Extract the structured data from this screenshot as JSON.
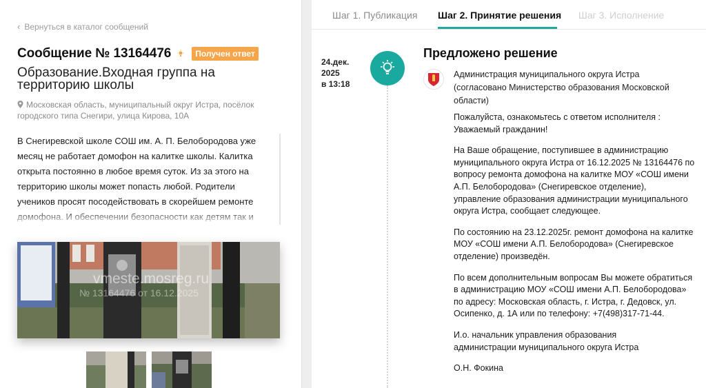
{
  "left": {
    "back_link": "Вернуться в каталог сообщений",
    "message_title": "Сообщение № 13164476",
    "status_badge": "Получен ответ",
    "category": "Образование.Входная группа на территорию школы",
    "address": "Московская область, муниципальный округ Истра, посёлок городского типа Снегири, улица Кирова, 10А",
    "description": "В Снегиревской школе СОШ им. А. П. Белобородова уже месяц не работает домофон на калитке школы. Калитка открыта постоянно в любое время суток. Из за этого на территорию школы может попасть любой. Родители учеников просят посодействовать в скорейшем ремонте домофона. И обеспечении безопасности как детям так и учителям.",
    "photo_watermark_site": "vmeste.mosreg.ru",
    "photo_watermark_id": "№ 13164476 от 16.12.2025"
  },
  "tabs": {
    "step1": "Шаг 1. Публикация",
    "step2": "Шаг 2. Принятие решения",
    "step3": "Шаг 3. Исполнение"
  },
  "timeline": {
    "date_line1": "24.дек.",
    "date_line2": "2025",
    "date_line3": "в 13:18"
  },
  "decision": {
    "title": "Предложено решение",
    "org": "Администрация муниципального округа Истра (согласовано Министерство образования Московской области)",
    "p1_line1": "Пожалуйста, ознакомьтесь с ответом исполнителя :",
    "p1_line2": "Уважаемый гражданин!",
    "p2": "На Ваше обращение, поступившее в администрацию муниципального округа Истра от 16.12.2025 № 13164476 по вопросу ремонта домофона на калитке МОУ «СОШ имени А.П. Белобородова» (Снегиревское отделение), управление образования администрации муниципального округа Истра, сообщает следующее.",
    "p3": "По состоянию на 23.12.2025г. ремонт домофона на калитке МОУ «СОШ имени А.П. Белобородова» (Снегиревское отделение) произведён.",
    "p4": "По всем дополнительным вопросам Вы можете обратиться в администрацию МОУ «СОШ имени А.П. Белобородова» по адресу: Московская область, г. Истра, г. Дедовск, ул. Осипенко, д. 1А или по телефону: +7(498)317-71-44.",
    "p5_line1": "И.о. начальник управления образования",
    "p5_line2": "администрации муниципального округа Истра",
    "p6": "О.Н. Фокина"
  },
  "colors": {
    "accent": "#1aa99f",
    "badge": "#f6a54a"
  },
  "icons": {
    "back": "chevron-left-icon",
    "title_badge": "lightbulb-icon",
    "address": "location-pin-icon",
    "timeline": "lightbulb-icon",
    "org": "emblem-icon"
  }
}
